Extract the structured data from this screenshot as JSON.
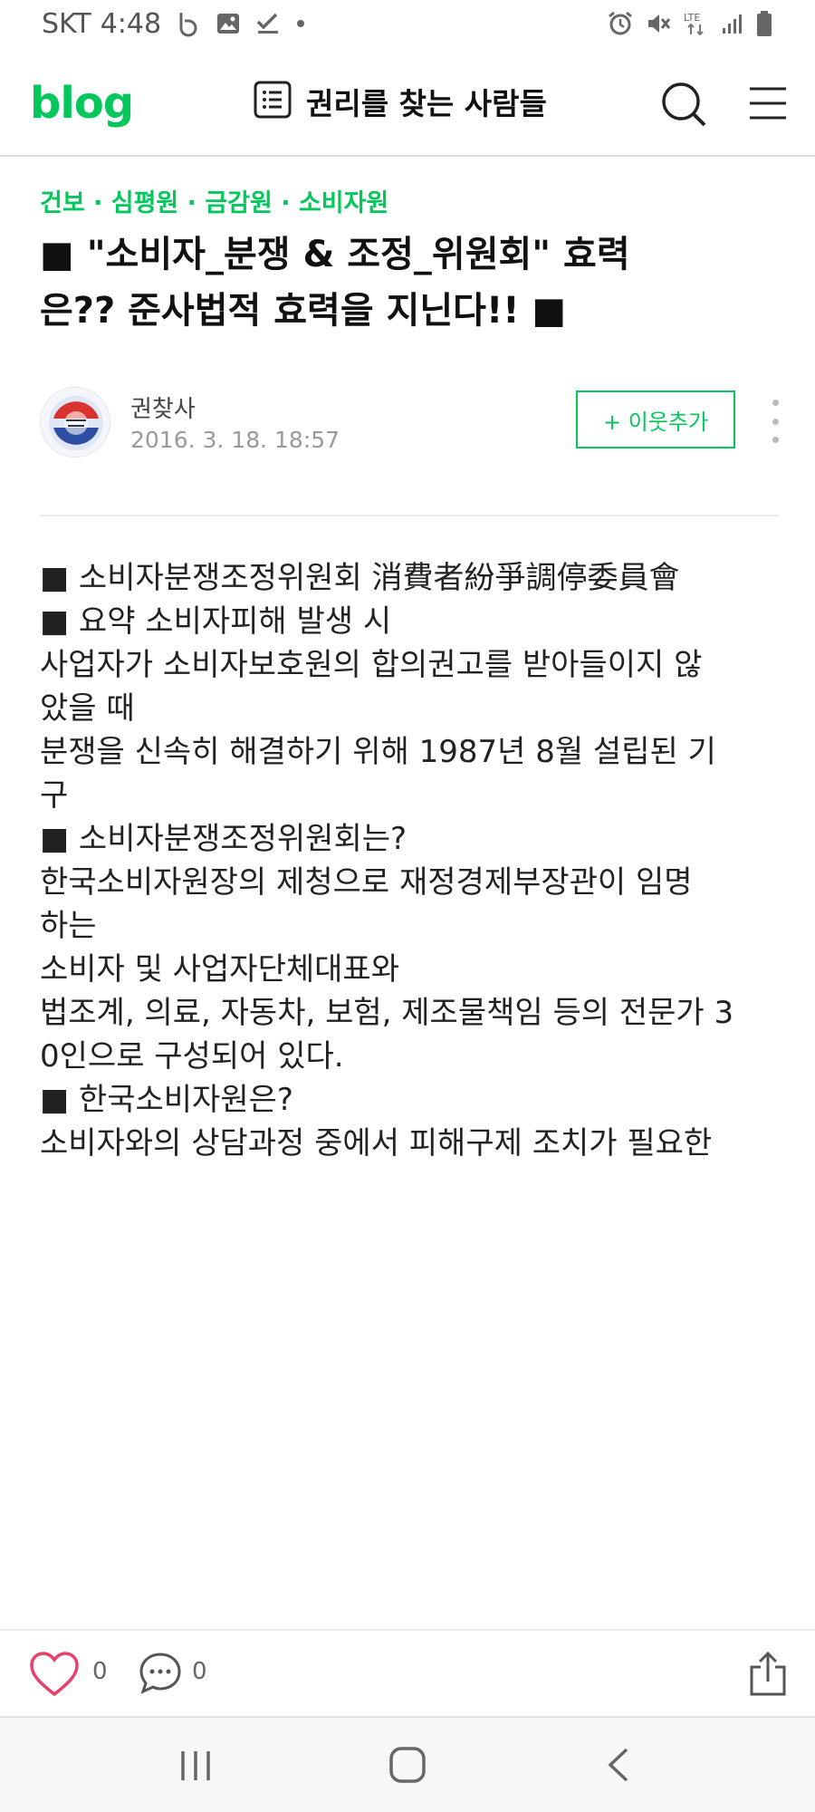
{
  "status_bar": {
    "carrier": "SKT",
    "time": "4:48",
    "network": "LTE"
  },
  "header": {
    "logo": "blog",
    "blog_title": "권리를 찾는 사람들"
  },
  "post": {
    "category": "건보 · 심평원 · 금감원 · 소비자원",
    "title_line1": "■ \"소비자_분쟁 & 조정_위원회\" 효력",
    "title_line2": "은?? 준사법적 효력을 지닌다!! ■",
    "author": "권찾사",
    "date": "2016. 3. 18. 18:57",
    "follow_label": "+ 이웃추가",
    "body": [
      "■ 소비자분쟁조정위원회 消費者紛爭調停委員會",
      "",
      "",
      "■ 요약 소비자피해 발생 시",
      "",
      "사업자가 소비자보호원의 합의권고를 받아들이지 않\n았을 때",
      "",
      "분쟁을 신속히 해결하기 위해 1987년 8월 설립된 기\n구",
      "",
      "",
      "■ 소비자분쟁조정위원회는?",
      "",
      "한국소비자원장의 제청으로 재정경제부장관이 임명\n하는",
      "",
      "소비자 및 사업자단체대표와",
      "법조계, 의료, 자동차, 보험, 제조물책임 등의 전문가 3\n0인으로 구성되어 있다.",
      "",
      "",
      "■ 한국소비자원은?",
      "",
      "소비자와의 상담과정 중에서 피해구제 조치가 필요한"
    ]
  },
  "actions": {
    "like_count": "0",
    "comment_count": "0"
  },
  "colors": {
    "accent": "#03c75a",
    "like": "#e8416a"
  },
  "icons": [
    "alarm-icon",
    "mute-icon",
    "signal-icon",
    "battery-icon",
    "list-icon",
    "search-icon",
    "menu-icon",
    "heart-icon",
    "comment-icon",
    "share-icon",
    "nav-recent-icon",
    "nav-home-icon",
    "nav-back-icon"
  ]
}
